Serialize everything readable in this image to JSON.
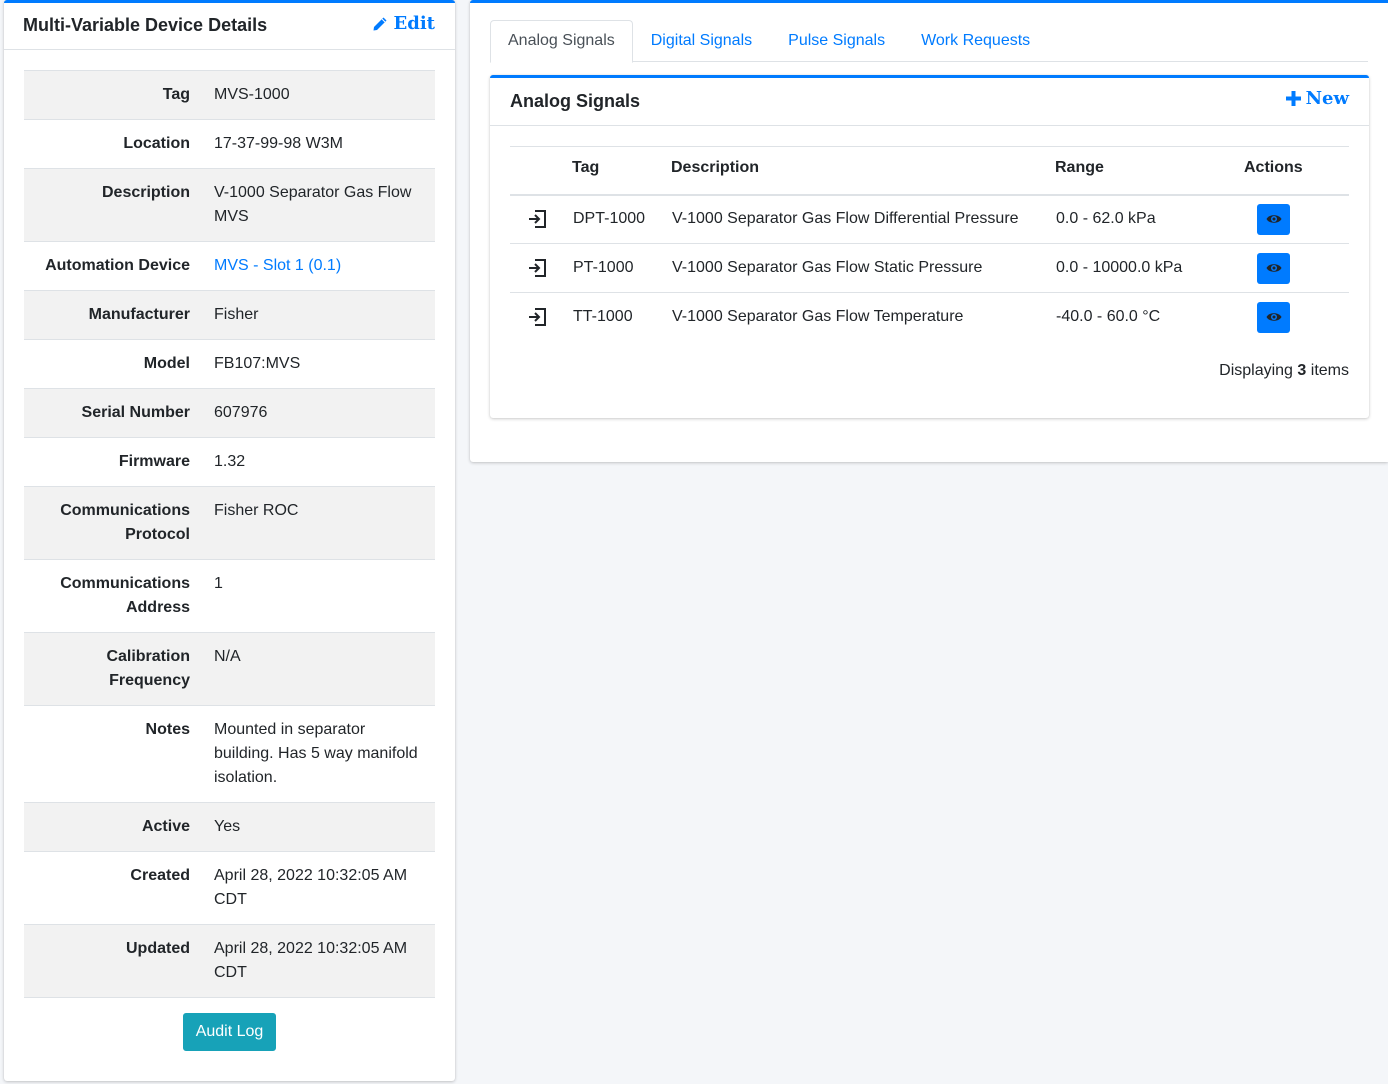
{
  "details_card": {
    "title": "Multi-Variable Device Details",
    "edit_label": "Edit",
    "rows": [
      {
        "label": "Tag",
        "value": "MVS-1000"
      },
      {
        "label": "Location",
        "value": "17-37-99-98 W3M"
      },
      {
        "label": "Description",
        "value": "V-1000 Separator Gas Flow MVS"
      },
      {
        "label": "Automation Device",
        "value": "MVS - Slot 1 (0.1)"
      },
      {
        "label": "Manufacturer",
        "value": "Fisher"
      },
      {
        "label": "Model",
        "value": "FB107:MVS"
      },
      {
        "label": "Serial Number",
        "value": "607976"
      },
      {
        "label": "Firmware",
        "value": "1.32"
      },
      {
        "label": "Communications Protocol",
        "value": "Fisher ROC"
      },
      {
        "label": "Communications Address",
        "value": "1"
      },
      {
        "label": "Calibration Frequency",
        "value": "N/A"
      },
      {
        "label": "Notes",
        "value": "Mounted in separator building. Has 5 way manifold isolation."
      },
      {
        "label": "Active",
        "value": "Yes"
      },
      {
        "label": "Created",
        "value": "April 28, 2022 10:32:05 AM CDT"
      },
      {
        "label": "Updated",
        "value": "April 28, 2022 10:32:05 AM CDT"
      }
    ],
    "audit_label": "Audit Log"
  },
  "tabs": [
    {
      "label": "Analog Signals",
      "active": true
    },
    {
      "label": "Digital Signals",
      "active": false
    },
    {
      "label": "Pulse Signals",
      "active": false
    },
    {
      "label": "Work Requests",
      "active": false
    }
  ],
  "signals_card": {
    "title": "Analog Signals",
    "new_label": "New",
    "columns": [
      "Tag",
      "Description",
      "Range",
      "Actions"
    ],
    "rows": [
      {
        "tag": "DPT-1000",
        "description": "V-1000 Separator Gas Flow Differential Pressure",
        "range": "0.0 - 62.0 kPa"
      },
      {
        "tag": "PT-1000",
        "description": "V-1000 Separator Gas Flow Static Pressure",
        "range": "0.0 - 10000.0 kPa"
      },
      {
        "tag": "TT-1000",
        "description": "V-1000 Separator Gas Flow Temperature",
        "range": "-40.0 - 60.0 °C"
      }
    ],
    "footer_prefix": "Displaying",
    "footer_count": "3",
    "footer_suffix": "items"
  },
  "colors": {
    "primary": "#007bff",
    "info": "#17a2b8"
  },
  "icons": {
    "edit": "pencil-icon",
    "new": "plus-icon",
    "signal": "sign-in-icon",
    "view": "eye-icon"
  }
}
